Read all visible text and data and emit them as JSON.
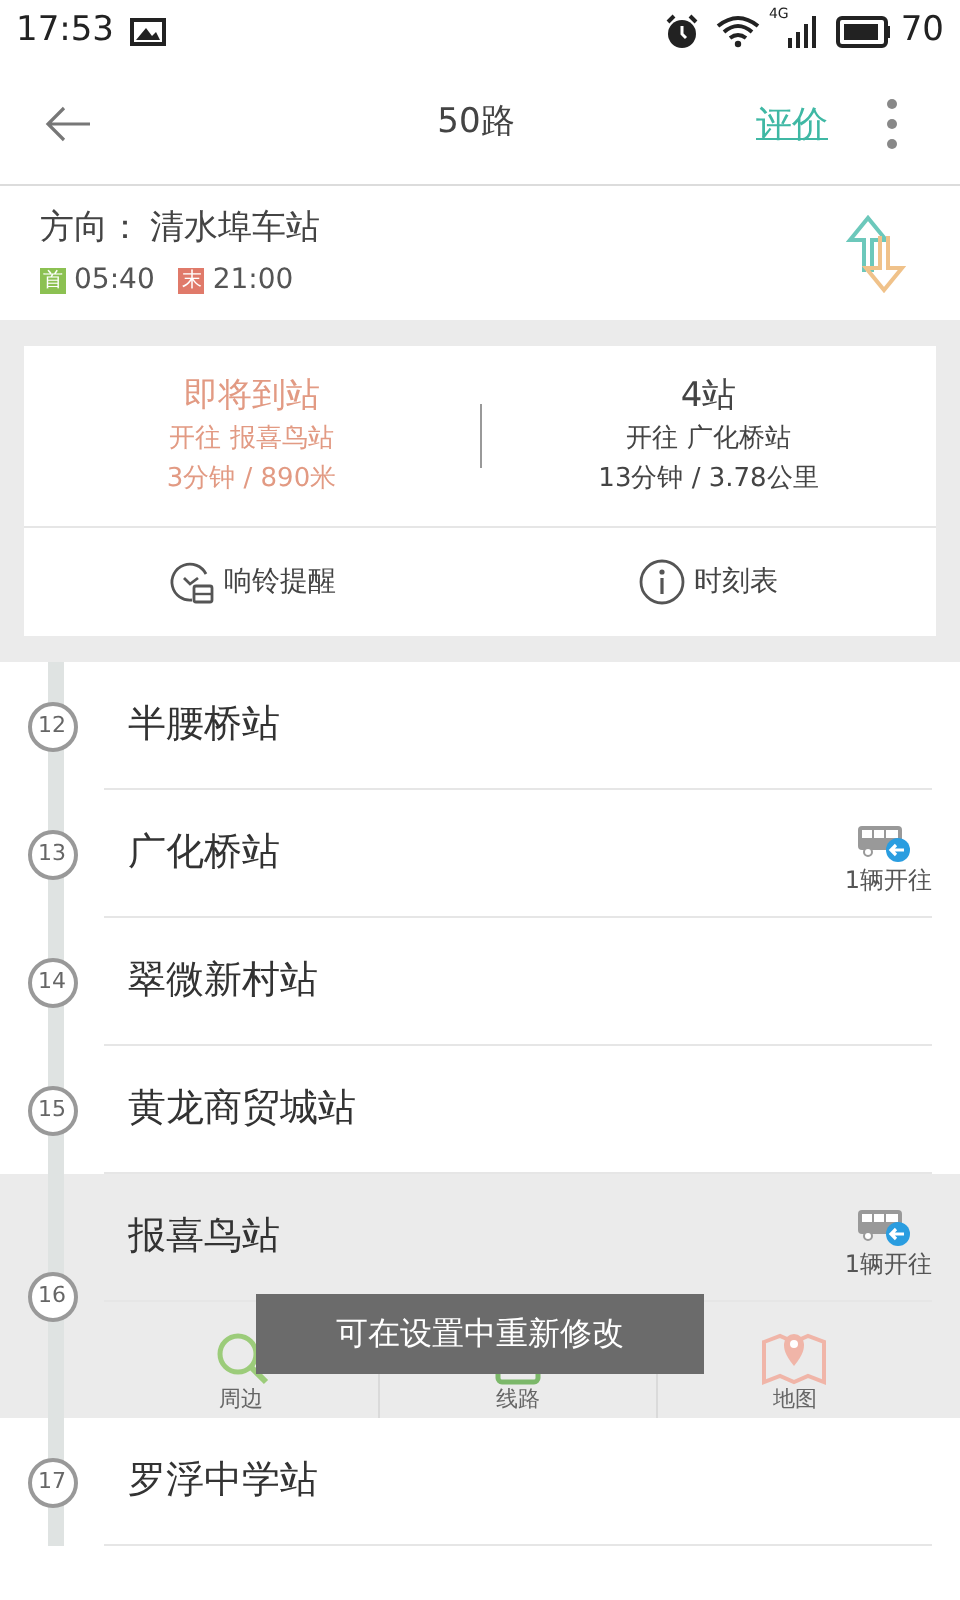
{
  "status_bar": {
    "time": "17:53",
    "network": "4G",
    "battery": "70"
  },
  "header": {
    "title": "50路",
    "action": "评价"
  },
  "direction": {
    "label": "方向：",
    "destination": "清水埠车站",
    "first_tag": "首",
    "first_time": "05:40",
    "last_tag": "末",
    "last_time": "21:00"
  },
  "arrivals": [
    {
      "status": "即将到站",
      "heading": "开往 报喜鸟站",
      "eta": "3分钟 / 890米",
      "imminent": true
    },
    {
      "status": "4站",
      "heading": "开往 广化桥站",
      "eta": "13分钟 / 3.78公里",
      "imminent": false
    }
  ],
  "actions": [
    {
      "kind": "alarm",
      "label": "响铃提醒"
    },
    {
      "kind": "info",
      "label": "时刻表"
    }
  ],
  "stations": [
    {
      "number": "12",
      "name": "半腰桥站",
      "selected": false
    },
    {
      "number": "13",
      "name": "广化桥站",
      "bus": "1辆开往",
      "selected": false
    },
    {
      "number": "14",
      "name": "翠微新村站",
      "selected": false
    },
    {
      "number": "15",
      "name": "黄龙商贸城站",
      "selected": false
    },
    {
      "number": "16",
      "name": "报喜鸟站",
      "bus": "1辆开往",
      "selected": true,
      "tools": [
        {
          "kind": "nearby",
          "label": "周边"
        },
        {
          "kind": "route",
          "label": "线路"
        },
        {
          "kind": "map",
          "label": "地图"
        }
      ]
    },
    {
      "number": "17",
      "name": "罗浮中学站",
      "selected": false
    }
  ],
  "toast": "可在设置中重新修改"
}
